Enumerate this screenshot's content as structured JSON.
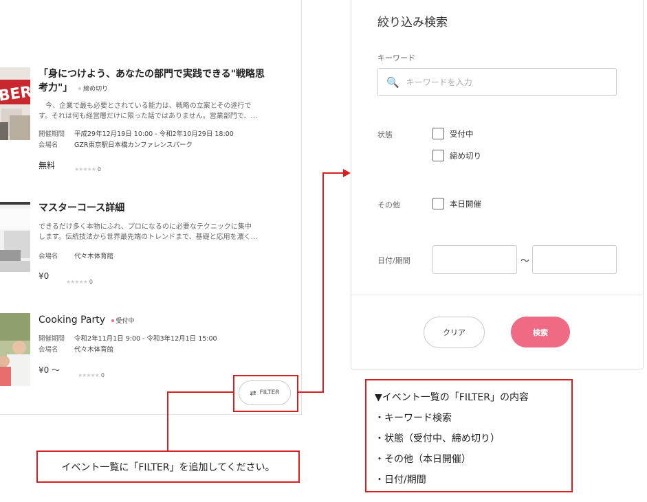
{
  "events": [
    {
      "title_line1": "「身につけよう、あなたの部門で実践できる\"戦略思",
      "title_line2": "考力\"」",
      "badge": "締め切り",
      "badge_color": "#cccccc",
      "desc_line1": "　今、企業で最も必要とされている能力は、戦略の立案とその遂行で",
      "desc_line2": "す。それは何も経営層だけに限った話ではありません。営業部門で、…",
      "period_label": "開催期間",
      "period": "平成29年12月19日 10:00 - 令和2年10月29日 18:00",
      "venue_label": "会場名",
      "venue": "GZR東京駅日本橋カンファレンスパーク",
      "price": "無料",
      "stars": "★★★★★",
      "count": "0"
    },
    {
      "title": "マスターコース詳細",
      "desc_line1": "できるだけ多く本物にふれ、プロになるのに必要なテクニックに集中",
      "desc_line2": "します。伝統技法から世界最先端のトレンドまで、基礎と応用を濃く…",
      "venue_label": "会場名",
      "venue": "代々木体育館",
      "price": "¥0",
      "stars": "★★★★★",
      "count": "0"
    },
    {
      "title": "Cooking Party",
      "badge": "受付中",
      "badge_color": "#ee6a85",
      "period_label": "開催期間",
      "period": "令和2年11月1日 9:00 - 令和3年12月1日 15:00",
      "venue_label": "会場名",
      "venue": "代々木体育館",
      "price": "¥0 〜",
      "stars": "★★★★★",
      "count": "0"
    }
  ],
  "filter_button": {
    "icon": "swap-arrows-icon",
    "label": "FILTER"
  },
  "search_panel": {
    "title": "絞り込み検索",
    "keyword_label": "キーワード",
    "keyword_placeholder": "キーワードを入力",
    "status_label": "状態",
    "status_options": [
      "受付中",
      "締め切り"
    ],
    "other_label": "その他",
    "other_options": [
      "本日開催"
    ],
    "date_label": "日付/期間",
    "date_separator": "〜",
    "clear_label": "クリア",
    "search_label": "検索"
  },
  "annotation": {
    "request": "イベント一覧に「FILTER」を追加してください。",
    "spec_title": "▼イベント一覧の「FILTER」の内容",
    "spec_items": [
      "・キーワード検索",
      "・状態（受付中、締め切り）",
      "・その他（本日開催）",
      "・日付/期間"
    ]
  },
  "colors": {
    "accent": "#ee6a85",
    "annotation_red": "#d61f1f"
  }
}
